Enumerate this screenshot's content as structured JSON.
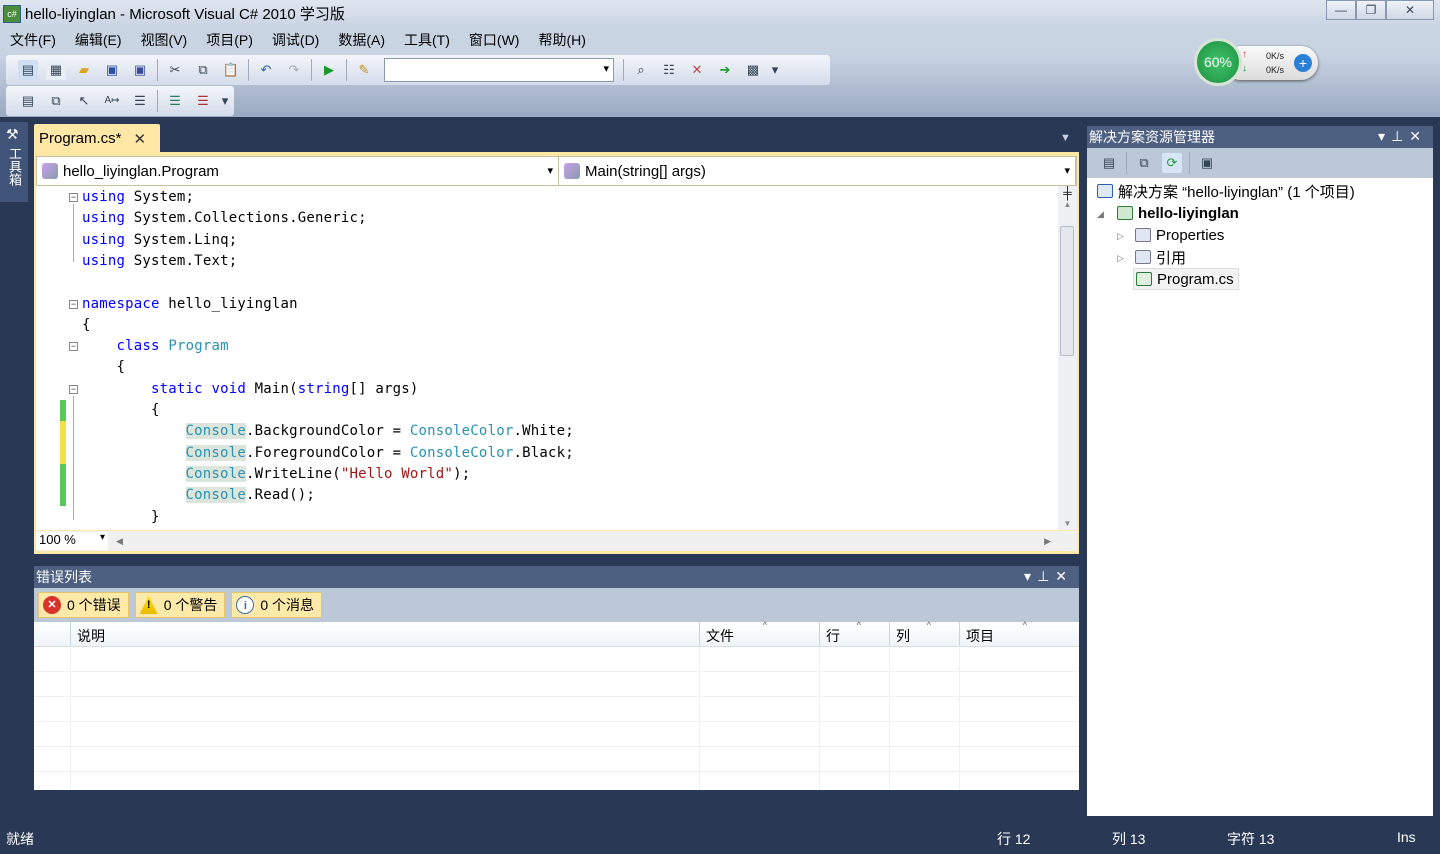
{
  "window": {
    "title": "hello-liyinglan - Microsoft Visual C# 2010 学习版",
    "app_icon": "csharp-icon"
  },
  "menu": [
    "文件(F)",
    "编辑(E)",
    "视图(V)",
    "项目(P)",
    "调试(D)",
    "数据(A)",
    "工具(T)",
    "窗口(W)",
    "帮助(H)"
  ],
  "toolbar": {
    "search_combo": ""
  },
  "gauge": {
    "percent": "60%",
    "upload": "0K/s",
    "download": "0K/s"
  },
  "toolbox": {
    "label": "工具箱"
  },
  "tab": {
    "label": "Program.cs*"
  },
  "nav": {
    "class": "hello_liyinglan.Program",
    "member": "Main(string[] args)"
  },
  "code": [
    [
      [
        "kw",
        "using"
      ],
      [
        "tx",
        " System;"
      ]
    ],
    [
      [
        "kw",
        "using"
      ],
      [
        "tx",
        " System.Collections.Generic;"
      ]
    ],
    [
      [
        "kw",
        "using"
      ],
      [
        "tx",
        " System.Linq;"
      ]
    ],
    [
      [
        "kw",
        "using"
      ],
      [
        "tx",
        " System.Text;"
      ]
    ],
    [],
    [
      [
        "kw",
        "namespace"
      ],
      [
        "tx",
        " hello_liyinglan"
      ]
    ],
    [
      [
        "tx",
        "{"
      ]
    ],
    [
      [
        "tx",
        "    "
      ],
      [
        "kw",
        "class"
      ],
      [
        "tx",
        " "
      ],
      [
        "ty",
        "Program"
      ]
    ],
    [
      [
        "tx",
        "    {"
      ]
    ],
    [
      [
        "tx",
        "        "
      ],
      [
        "kw",
        "static"
      ],
      [
        "tx",
        " "
      ],
      [
        "kw",
        "void"
      ],
      [
        "tx",
        " Main("
      ],
      [
        "kw",
        "string"
      ],
      [
        "tx",
        "[] args)"
      ]
    ],
    [
      [
        "tx",
        "        {"
      ]
    ],
    [
      [
        "tx",
        "            "
      ],
      [
        "hl",
        "Console"
      ],
      [
        "tx",
        ".BackgroundColor = "
      ],
      [
        "ty",
        "ConsoleColor"
      ],
      [
        "tx",
        ".White;"
      ]
    ],
    [
      [
        "tx",
        "            "
      ],
      [
        "hl",
        "Console"
      ],
      [
        "tx",
        ".ForegroundColor = "
      ],
      [
        "ty",
        "ConsoleColor"
      ],
      [
        "tx",
        ".Black;"
      ]
    ],
    [
      [
        "tx",
        "            "
      ],
      [
        "hl",
        "Console"
      ],
      [
        "tx",
        ".WriteLine("
      ],
      [
        "st",
        "\"Hello World\""
      ],
      [
        "tx",
        ");"
      ]
    ],
    [
      [
        "tx",
        "            "
      ],
      [
        "hl",
        "Console"
      ],
      [
        "tx",
        ".Read();"
      ]
    ],
    [
      [
        "tx",
        "        }"
      ]
    ]
  ],
  "editor": {
    "zoom": "100 %"
  },
  "error_list": {
    "title": "错误列表",
    "errors": "0 个错误",
    "warnings": "0 个警告",
    "messages": "0 个消息",
    "columns": [
      "说明",
      "文件",
      "行",
      "列",
      "项目"
    ]
  },
  "solution": {
    "title": "解决方案资源管理器",
    "root": "解决方案 “hello-liyinglan” (1 个项目)",
    "project": "hello-liyinglan",
    "items": [
      "Properties",
      "引用",
      "Program.cs"
    ]
  },
  "status": {
    "ready": "就绪",
    "line": "行 12",
    "col": "列 13",
    "char": "字符 13",
    "mode": "Ins"
  }
}
